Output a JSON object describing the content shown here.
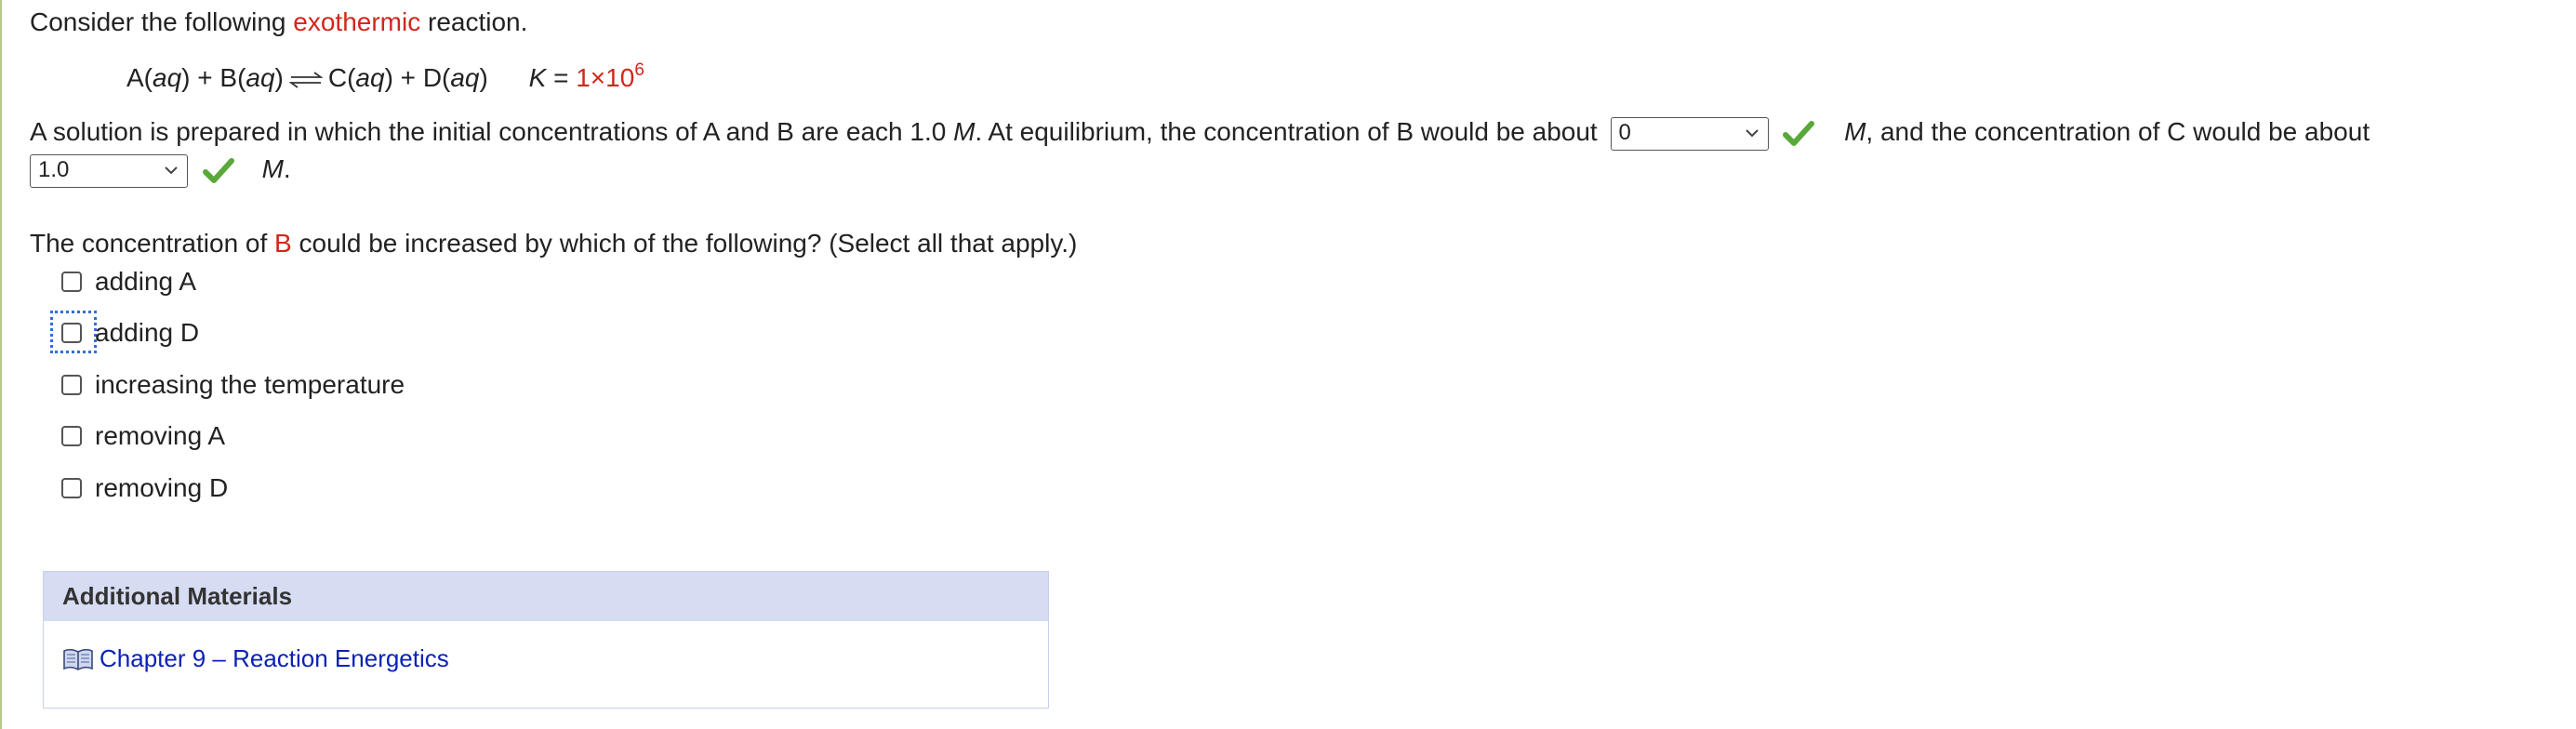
{
  "intro": {
    "before": "Consider the following ",
    "keyword": "exothermic",
    "after": " reaction."
  },
  "equation": {
    "a": "A(",
    "a_phase": "aq",
    "a_close": ") + B(",
    "b_phase": "aq",
    "b_close": ")",
    "c": "C(",
    "c_phase": "aq",
    "c_close": ") + D(",
    "d_phase": "aq",
    "d_close": ")",
    "k_label": "K",
    "k_eq": " = ",
    "k_value": "1×10",
    "k_exp": "6"
  },
  "para1": {
    "text1": "A solution is prepared in which the initial concentrations of A and B are each 1.0 ",
    "unit": "M",
    "text2": ". At equilibrium, the concentration of B would be about",
    "after_select1_unit": "M",
    "after_select1_text": ", and the concentration of C would be about",
    "after_select2_unit": "M",
    "after_select2_text": "."
  },
  "select_b": {
    "value": "0"
  },
  "select_c": {
    "value": "1.0"
  },
  "question2": {
    "before": "The concentration of ",
    "keyword": "B",
    "after": " could be increased by which of the following? (Select all that apply.)"
  },
  "options": [
    {
      "label": "adding A",
      "checked": false
    },
    {
      "label": "adding D",
      "checked": false
    },
    {
      "label": "increasing the temperature",
      "checked": false
    },
    {
      "label": "removing A",
      "checked": false
    },
    {
      "label": "removing D",
      "checked": false
    }
  ],
  "additional": {
    "title": "Additional Materials",
    "link": "Chapter 9 – Reaction Energetics"
  },
  "colors": {
    "accent_red": "#d0281c",
    "check_green": "#5aa83a",
    "panel_bg": "#d6dcf2",
    "link_blue": "#0b22b5",
    "focus_blue": "#2f6fd6"
  },
  "icons": {
    "correct": "check-icon",
    "dropdown": "chevron-down-icon",
    "material": "book-icon"
  }
}
